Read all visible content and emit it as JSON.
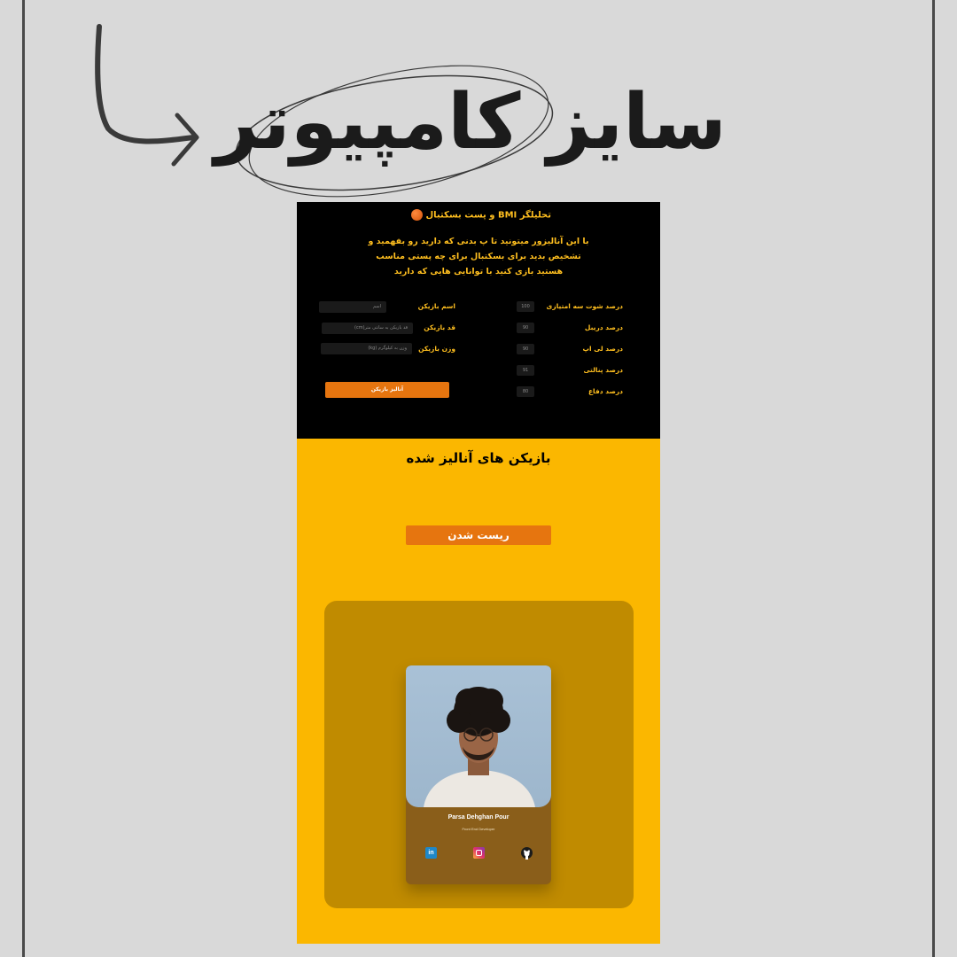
{
  "headline": {
    "text": "سایز کامپیوتر"
  },
  "app": {
    "title": "تحلیلگر BMI و پست بسکتبال",
    "intro": "با این آنالیزور میتونید تا پ بدنی که دارید رو بفهمید و تشخیص بدید برای بسکتبال برای چه پستی مناسب هستید بازی کنید با توانایی هایی که دارید",
    "stats": [
      {
        "label": "درصد شوت سه امتیازی",
        "value": "100"
      },
      {
        "label": "درصد دریبل",
        "value": "90"
      },
      {
        "label": "درصد لی اپ",
        "value": "90"
      },
      {
        "label": "درصد پنالتی",
        "value": "91"
      },
      {
        "label": "درصد دفاع",
        "value": "80"
      }
    ],
    "fields": [
      {
        "label": "اسم بازیکن",
        "placeholder": "اسم"
      },
      {
        "label": "قد بازیکن",
        "placeholder": "قد بازیکن به سانتی متر(cm)"
      },
      {
        "label": "وزن بازیکن",
        "placeholder": "وزن به کیلوگرم (kg)"
      }
    ],
    "analyze_button": "آنالیز بازیکن",
    "players_heading": "بازیکن های آنالیز شده",
    "reset_button": "ریست شدن",
    "card": {
      "name": "Parsa Dehghan Pour",
      "role": "Front End Developer",
      "socials": [
        {
          "icon": "linkedin-icon",
          "glyph": "in"
        },
        {
          "icon": "instagram-icon"
        },
        {
          "icon": "github-icon"
        }
      ]
    }
  },
  "colors": {
    "background": "#d9d9d9",
    "app_dark": "#000000",
    "app_yellow": "#fbb700",
    "accent_orange": "#e6750f",
    "text_yellow": "#ffbf1f",
    "panel": "#c08b00",
    "card": "#8a5e1a"
  }
}
